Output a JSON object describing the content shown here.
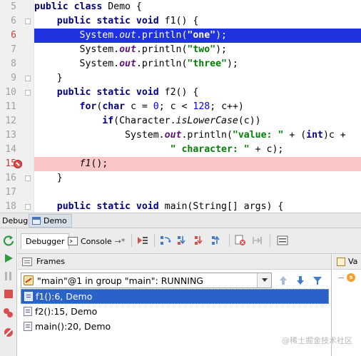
{
  "editor": {
    "lines": [
      {
        "no": "5",
        "text": "public class Demo {"
      },
      {
        "no": "6",
        "text": "    public static void f1() {"
      },
      {
        "no": "6",
        "text": "        System.out.println(\"one\");"
      },
      {
        "no": "7",
        "text": "        System.out.println(\"two\");"
      },
      {
        "no": "8",
        "text": "        System.out.println(\"three\");"
      },
      {
        "no": "9",
        "text": "    }"
      },
      {
        "no": "10",
        "text": "    public static void f2() {"
      },
      {
        "no": "11",
        "text": "        for(char c = 0; c < 128; c++)"
      },
      {
        "no": "12",
        "text": "            if(Character.isLowerCase(c))"
      },
      {
        "no": "13",
        "text": "                System.out.println(\"value: \" + (int)c +"
      },
      {
        "no": "14",
        "text": "                        \" character: \" + c);"
      },
      {
        "no": "15",
        "text": "        f1();"
      },
      {
        "no": "16",
        "text": "    }"
      },
      {
        "no": "17",
        "text": ""
      },
      {
        "no": "18",
        "text": "    public static void main(String[] args) {"
      }
    ]
  },
  "debug_header": {
    "label": "Debug",
    "tab": "Demo"
  },
  "toolbar": {
    "tabs": [
      "Debugger",
      "Console"
    ],
    "console_suffix": "→*"
  },
  "frames": {
    "title": "Frames",
    "thread": "\"main\"@1 in group \"main\": RUNNING",
    "items": [
      "f1():6, Demo",
      "f2():15, Demo",
      "main():20, Demo"
    ]
  },
  "variables": {
    "title": "Va"
  },
  "watermark": "@稀土掘金技术社区",
  "colors": {
    "selection": "#1f32e0",
    "breakpoint_line": "#f9c5c5",
    "frame_selected": "#2a62c9",
    "keyword": "#000080",
    "string": "#008000"
  }
}
